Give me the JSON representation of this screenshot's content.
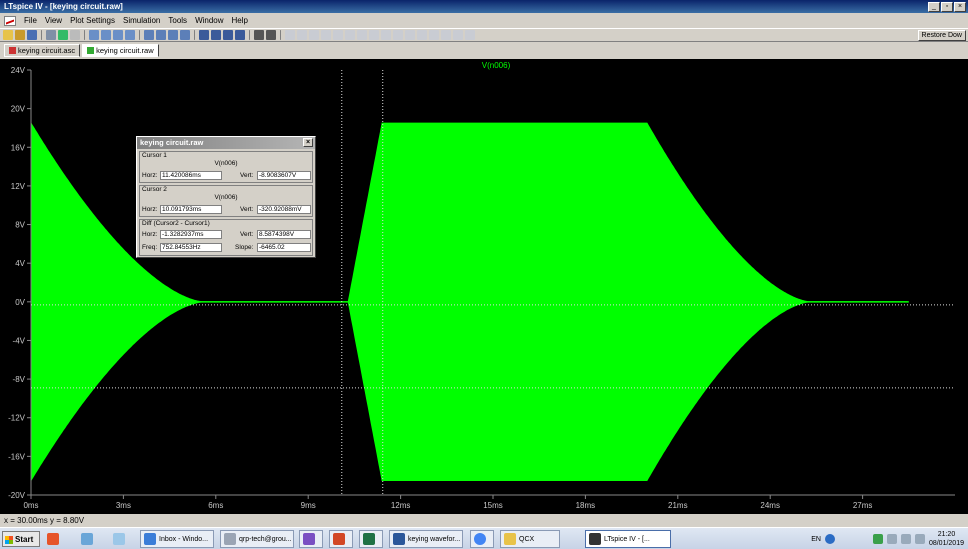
{
  "window": {
    "title": "LTspice IV - [keying circuit.raw]",
    "restore_label": "Restore Dow"
  },
  "menu": [
    "File",
    "View",
    "Plot Settings",
    "Simulation",
    "Tools",
    "Window",
    "Help"
  ],
  "tabs": [
    {
      "label": "keying circuit.asc",
      "icon": "schematic-icon"
    },
    {
      "label": "keying circuit.raw",
      "icon": "waveform-icon"
    }
  ],
  "plot": {
    "trace_label": "V(n006)",
    "trace_color": "#00ff00",
    "background": "#000000",
    "y_ticks": [
      "24V",
      "20V",
      "16V",
      "12V",
      "8V",
      "4V",
      "0V",
      "-4V",
      "-8V",
      "-12V",
      "-16V",
      "-20V"
    ],
    "x_ticks": [
      "0ms",
      "3ms",
      "6ms",
      "9ms",
      "12ms",
      "15ms",
      "18ms",
      "21ms",
      "24ms",
      "27ms"
    ],
    "cursor1_time_ms": 11.42,
    "cursor2_time_ms": 10.09,
    "cursor1_value_v": -8.908,
    "cursor2_value_v": -0.321
  },
  "status": {
    "text": "x = 30.00ms   y = 8.80V"
  },
  "cursor_dialog": {
    "title": "keying circuit.raw",
    "cursor1_label": "Cursor 1",
    "cursor1_trace": "V(n006)",
    "cursor2_label": "Cursor 2",
    "cursor2_trace": "V(n006)",
    "diff_label": "Diff (Cursor2 - Cursor1)",
    "horz_label": "Horz:",
    "vert_label": "Vert:",
    "freq_label": "Freq:",
    "slope_label": "Slope:",
    "c1_horz": "11.420086ms",
    "c1_vert": "-8.9083607V",
    "c2_horz": "10.091793ms",
    "c2_vert": "-320.92088mV",
    "diff_horz": "-1.3282937ms",
    "diff_vert": "8.5874398V",
    "diff_freq": "752.84553Hz",
    "diff_slope": "-6465.02"
  },
  "taskbar": {
    "start_label": "Start",
    "items": [
      {
        "label": "Inbox - Windo...",
        "icon_color": "#3b7dd8"
      },
      {
        "label": "qrp-tech@grou...",
        "icon_color": "#9aa4b4"
      },
      {
        "label": "",
        "icon_color": "#7a4fc2",
        "letter": "V"
      },
      {
        "label": "",
        "icon_color": "#d24726",
        "letter": "P"
      },
      {
        "label": "",
        "icon_color": "#1e7145",
        "letter": "X"
      },
      {
        "label": "keying wavefor...",
        "icon_color": "#2b579a",
        "letter": "W"
      },
      {
        "label": "",
        "icon_color": "#4285f4"
      },
      {
        "label": "QCX",
        "icon_color": "#e8c34a"
      },
      {
        "label": "LTspice IV - [...",
        "icon_color": "#333333"
      }
    ],
    "lang": "EN",
    "time": "21:20",
    "date": "08/01/2019"
  }
}
